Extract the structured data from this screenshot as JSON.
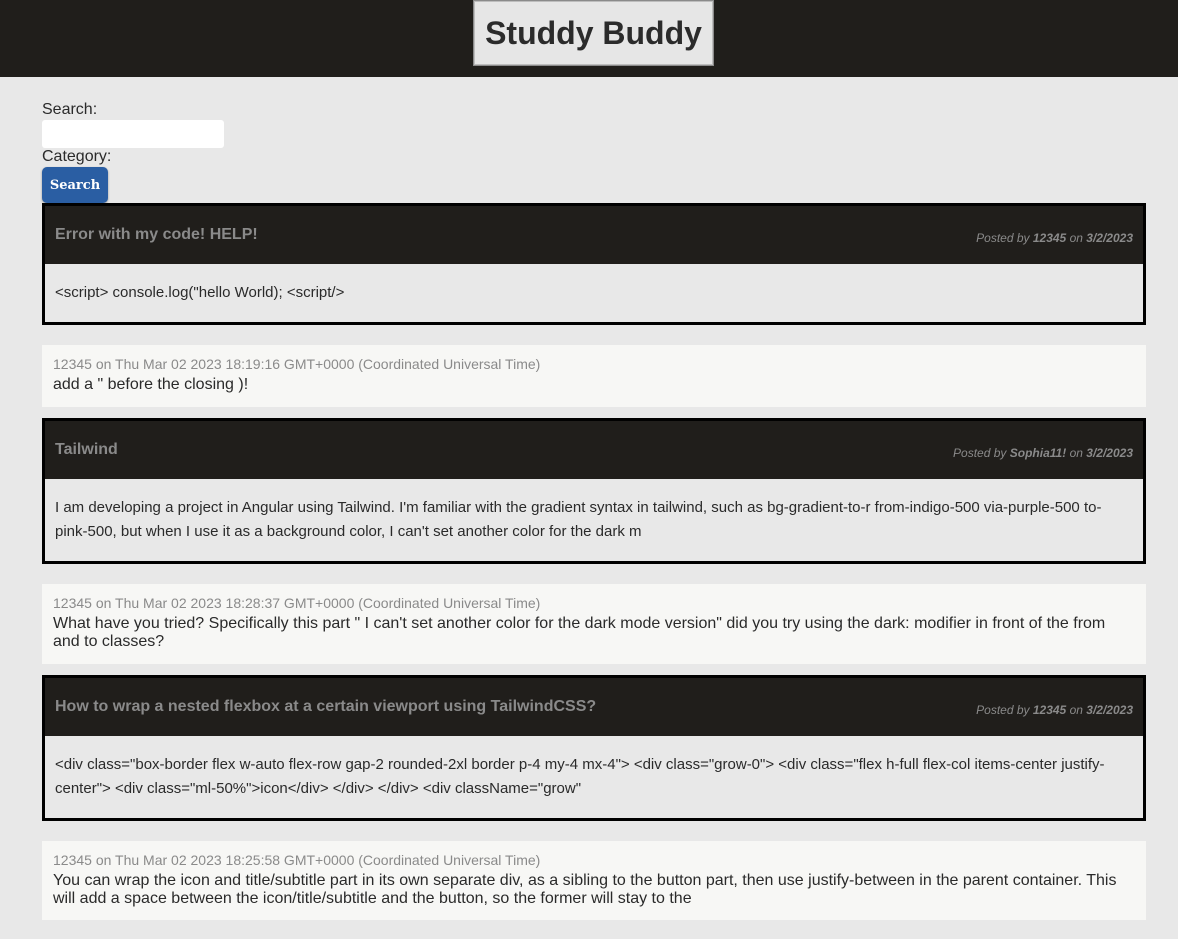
{
  "header": {
    "brand": "Studdy Buddy"
  },
  "search": {
    "search_label": "Search:",
    "input_value": "",
    "category_label": "Category:",
    "button_label": "Search"
  },
  "posts": [
    {
      "title": "Error with my code! HELP!",
      "posted_by_prefix": "Posted by",
      "author": "12345",
      "on_word": "on",
      "date": "3/2/2023",
      "body": "<script> console.log(\"hello World); <script/>",
      "comment": {
        "meta": "12345 on Thu Mar 02 2023 18:19:16 GMT+0000 (Coordinated Universal Time)",
        "text": "add a \" before the closing )!"
      }
    },
    {
      "title": "Tailwind",
      "posted_by_prefix": "Posted by",
      "author": "Sophia11!",
      "on_word": "on",
      "date": "3/2/2023",
      "body": "I am developing a project in Angular using Tailwind. I'm familiar with the gradient syntax in tailwind, such as bg-gradient-to-r from-indigo-500 via-purple-500 to-pink-500, but when I use it as a background color, I can't set another color for the dark m",
      "comment": {
        "meta": "12345 on Thu Mar 02 2023 18:28:37 GMT+0000 (Coordinated Universal Time)",
        "text": "What have you tried? Specifically this part \" I can't set another color for the dark mode version\" did you try using the dark: modifier in front of the from and to classes?"
      }
    },
    {
      "title": "How to wrap a nested flexbox at a certain viewport using TailwindCSS?",
      "posted_by_prefix": "Posted by",
      "author": "12345",
      "on_word": "on",
      "date": "3/2/2023",
      "body": "<div class=\"box-border flex w-auto flex-row gap-2 rounded-2xl border p-4 my-4 mx-4\"> <div class=\"grow-0\"> <div class=\"flex h-full flex-col items-center justify-center\"> <div class=\"ml-50%\">icon</div> </div> </div> <div className=\"grow\"",
      "comment": {
        "meta": "12345 on Thu Mar 02 2023 18:25:58 GMT+0000 (Coordinated Universal Time)",
        "text": "You can wrap the icon and title/subtitle part in its own separate div, as a sibling to the button part, then use justify-between in the parent container. This will add a space between the icon/title/subtitle and the button, so the former will stay to the"
      }
    }
  ]
}
